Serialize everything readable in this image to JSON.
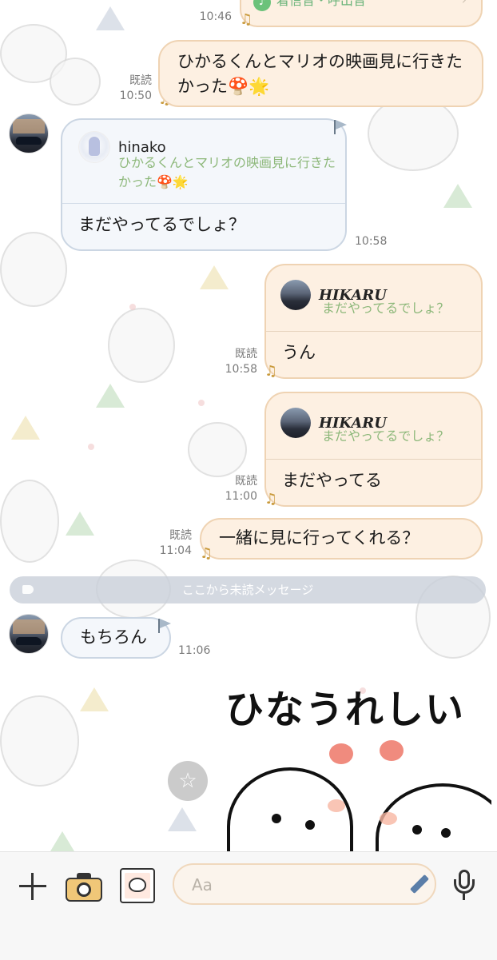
{
  "chat": {
    "messages": [
      {
        "id": "m0",
        "direction": "out",
        "type": "call",
        "label": "着信音・呼出音",
        "time": "10:46"
      },
      {
        "id": "m1",
        "direction": "out",
        "text": "ひかるくんとマリオの映画見に行きたかった🍄🌟",
        "read": "既読",
        "time": "10:50"
      },
      {
        "id": "m2",
        "direction": "in",
        "reply_to": {
          "name": "hinako",
          "text": "ひかるくんとマリオの映画見に行きたかった🍄🌟"
        },
        "text": "まだやってるでしょ？",
        "time": "10:58"
      },
      {
        "id": "m3",
        "direction": "out",
        "reply_to": {
          "name": "HIKARU",
          "text": "まだやってるでしょ？"
        },
        "text": "うん",
        "read": "既読",
        "time": "10:58"
      },
      {
        "id": "m4",
        "direction": "out",
        "reply_to": {
          "name": "HIKARU",
          "text": "まだやってるでしょ？"
        },
        "text": "まだやってる",
        "read": "既読",
        "time": "11:00"
      },
      {
        "id": "m5",
        "direction": "out",
        "text": "一緒に見に行ってくれる？",
        "read": "既読",
        "time": "11:04"
      },
      {
        "id": "m6",
        "direction": "in",
        "text": "もちろん",
        "time": "11:06"
      }
    ],
    "unread_divider": "ここから未読メッセージ",
    "sticker_text": "ひなうれしい"
  },
  "toolbar": {
    "input_placeholder": "Aa",
    "icons": [
      "plus-icon",
      "camera-icon",
      "sticker-icon",
      "pen-icon",
      "mic-icon"
    ]
  },
  "colors": {
    "outgoing_bubble": "#fdf0e2",
    "incoming_bubble": "#f4f7fb",
    "reply_quote": "#8db87a"
  }
}
